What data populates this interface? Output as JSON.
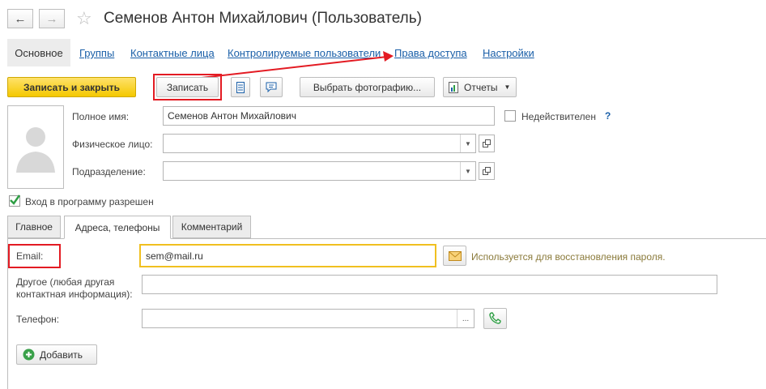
{
  "window": {
    "title": "Семенов Антон Михайлович (Пользователь)"
  },
  "nav": {
    "tabs": [
      {
        "label": "Основное"
      },
      {
        "label": "Группы"
      },
      {
        "label": "Контактные лица"
      },
      {
        "label": "Контролируемые пользователи"
      },
      {
        "label": "Права доступа"
      },
      {
        "label": "Настройки"
      }
    ]
  },
  "toolbar": {
    "save_close": "Записать и закрыть",
    "save": "Записать",
    "choose_photo": "Выбрать фотографию...",
    "reports": "Отчеты"
  },
  "form": {
    "full_name_label": "Полное имя:",
    "full_name_value": "Семенов Антон Михайлович",
    "invalid_label": "Недействителен",
    "help_mark": "?",
    "individual_label": "Физическое лицо:",
    "individual_value": "",
    "department_label": "Подразделение:",
    "department_value": "",
    "login_allowed_label": "Вход в программу разрешен"
  },
  "tabs": [
    {
      "label": "Главное"
    },
    {
      "label": "Адреса, телефоны"
    },
    {
      "label": "Комментарий"
    }
  ],
  "contacts": {
    "email_label": "Email:",
    "email_value": "sem@mail.ru",
    "email_hint": "Используется для восстановления пароля.",
    "other_label_line1": "Другое (любая другая",
    "other_label_line2": "контактная информация):",
    "other_value": "",
    "phone_label": "Телефон:",
    "phone_value": "",
    "phone_ellipsis": "...",
    "add_button": "Добавить"
  },
  "colors": {
    "accent_yellow": "#f4c800",
    "link": "#1a5fa8",
    "annotation_red": "#e31b23",
    "focus_border": "#f0c020"
  }
}
